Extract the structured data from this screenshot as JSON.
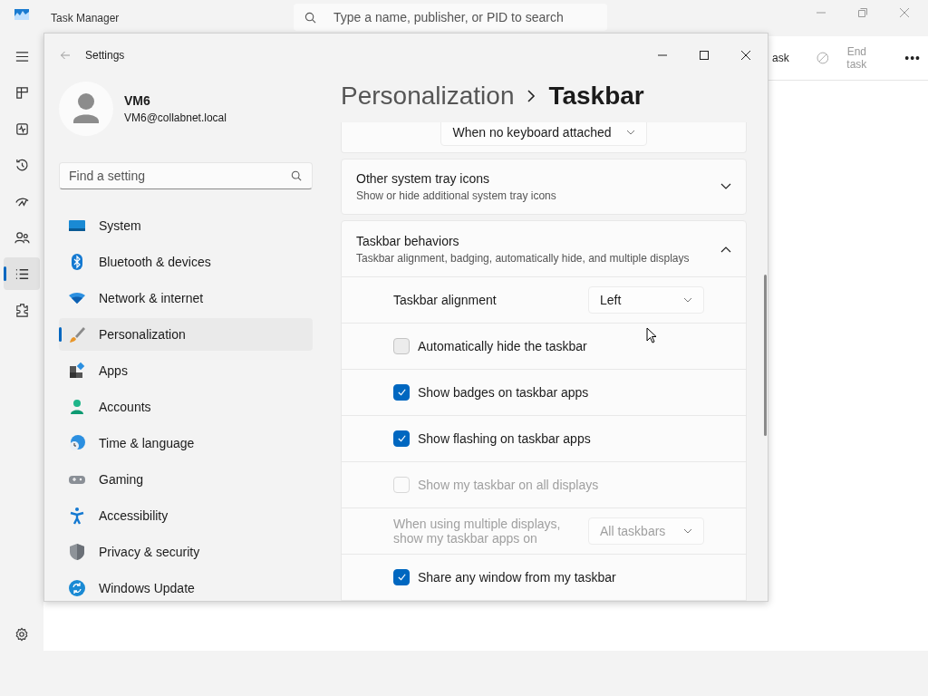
{
  "task_manager": {
    "title": "Task Manager",
    "search": {
      "placeholder": "Type a name, publisher, or PID to search"
    },
    "nav": [
      {
        "kind": "menu",
        "selected": false
      },
      {
        "kind": "processes",
        "selected": false
      },
      {
        "kind": "performance",
        "selected": false
      },
      {
        "kind": "history",
        "selected": false
      },
      {
        "kind": "startup",
        "selected": false
      },
      {
        "kind": "users",
        "selected": false
      },
      {
        "kind": "details",
        "selected": true
      },
      {
        "kind": "services",
        "selected": false
      }
    ],
    "toolbar": [
      {
        "label": "ask",
        "disabled": false
      },
      {
        "label": "End task",
        "disabled": true
      }
    ],
    "more": "•••"
  },
  "settings": {
    "title": "Settings",
    "user": {
      "name": "VM6",
      "email": "VM6@collabnet.local"
    },
    "search": {
      "placeholder": "Find a setting"
    },
    "nav": [
      {
        "label": "System",
        "kind": "system",
        "selected": false
      },
      {
        "label": "Bluetooth & devices",
        "kind": "bluetooth",
        "selected": false
      },
      {
        "label": "Network & internet",
        "kind": "network",
        "selected": false
      },
      {
        "label": "Personalization",
        "kind": "personalization",
        "selected": true
      },
      {
        "label": "Apps",
        "kind": "apps",
        "selected": false
      },
      {
        "label": "Accounts",
        "kind": "accounts",
        "selected": false
      },
      {
        "label": "Time & language",
        "kind": "time",
        "selected": false
      },
      {
        "label": "Gaming",
        "kind": "gaming",
        "selected": false
      },
      {
        "label": "Accessibility",
        "kind": "accessibility",
        "selected": false
      },
      {
        "label": "Privacy & security",
        "kind": "privacy",
        "selected": false
      },
      {
        "label": "Windows Update",
        "kind": "update",
        "selected": false
      }
    ],
    "breadcrumb": [
      "Personalization",
      "Taskbar"
    ],
    "top_dropdown": {
      "value": "When no keyboard attached"
    },
    "cards": [
      {
        "title": "Other system tray icons",
        "description": "Show or hide additional system tray icons",
        "expanded": false
      },
      {
        "title": "Taskbar behaviors",
        "description": "Taskbar alignment, badging, automatically hide, and multiple displays",
        "expanded": true
      }
    ],
    "behaviors": [
      {
        "kind": "dropdown",
        "label": "Taskbar alignment",
        "value": "Left",
        "disabled": false
      },
      {
        "kind": "checkbox",
        "label": "Automatically hide the taskbar",
        "checked": false,
        "disabled": false
      },
      {
        "kind": "checkbox",
        "label": "Show badges on taskbar apps",
        "checked": true,
        "disabled": false
      },
      {
        "kind": "checkbox",
        "label": "Show flashing on taskbar apps",
        "checked": true,
        "disabled": false
      },
      {
        "kind": "checkbox",
        "label": "Show my taskbar on all displays",
        "checked": false,
        "disabled": true
      },
      {
        "kind": "dropdown",
        "label": "When using multiple displays, show my taskbar apps on",
        "value": "All taskbars",
        "disabled": true
      },
      {
        "kind": "checkbox",
        "label": "Share any window from my taskbar",
        "checked": true,
        "disabled": false
      }
    ]
  }
}
